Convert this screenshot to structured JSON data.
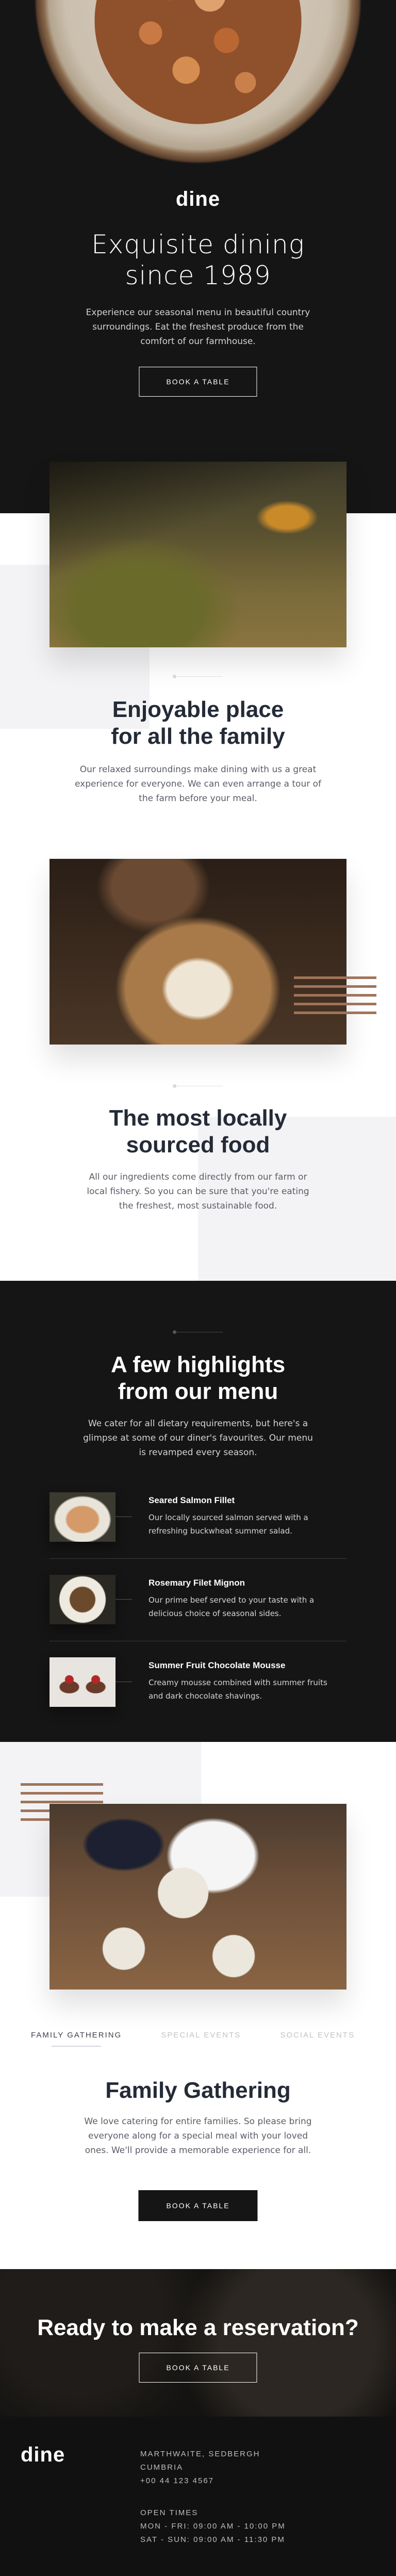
{
  "hero": {
    "logo": "dine",
    "title_line1": "Exquisite dining",
    "title_line2": "since 1989",
    "text": "Experience our seasonal menu in beautiful country surroundings. Eat the freshest produce from the comfort of our farmhouse.",
    "button": "BOOK A TABLE"
  },
  "family_section": {
    "title_line1": "Enjoyable place",
    "title_line2": "for all the family",
    "text": "Our relaxed surroundings make dining with us a great experience for everyone. We can even arrange a tour of the farm before your meal."
  },
  "local_section": {
    "title_line1": "The most locally",
    "title_line2": "sourced food",
    "text": "All our ingredients come directly from our farm or local fishery. So you can be sure that you're eating the freshest, most sustainable food."
  },
  "highlights": {
    "title_line1": "A few highlights",
    "title_line2": "from our menu",
    "text": "We cater for all dietary requirements, but here's a glimpse at some of our diner's favourites. Our menu is revamped every season.",
    "items": [
      {
        "name": "Seared Salmon Fillet",
        "desc": "Our locally sourced salmon served with a refreshing buckwheat summer salad."
      },
      {
        "name": "Rosemary Filet Mignon",
        "desc": "Our prime beef served to your taste with a delicious choice of seasonal sides."
      },
      {
        "name": "Summer Fruit Chocolate Mousse",
        "desc": "Creamy mousse combined with summer fruits and dark chocolate shavings."
      }
    ]
  },
  "events": {
    "tabs": [
      "FAMILY GATHERING",
      "SPECIAL EVENTS",
      "SOCIAL EVENTS"
    ],
    "active_tab": "FAMILY GATHERING",
    "title": "Family Gathering",
    "text": "We love catering for entire families. So please bring everyone along for a special meal with your loved ones. We'll provide a memorable experience for all.",
    "button": "BOOK A TABLE"
  },
  "reservation": {
    "title": "Ready to make a reservation?",
    "button": "BOOK A TABLE"
  },
  "footer": {
    "logo": "dine",
    "address_line1": "MARTHWAITE, SEDBERGH",
    "address_line2": "CUMBRIA",
    "phone": "+00 44 123 4567",
    "hours_label": "OPEN TIMES",
    "hours_weekday": "MON - FRI: 09:00 AM - 10:00 PM",
    "hours_weekend": "SAT - SUN: 09:00 AM - 11:30 PM"
  }
}
